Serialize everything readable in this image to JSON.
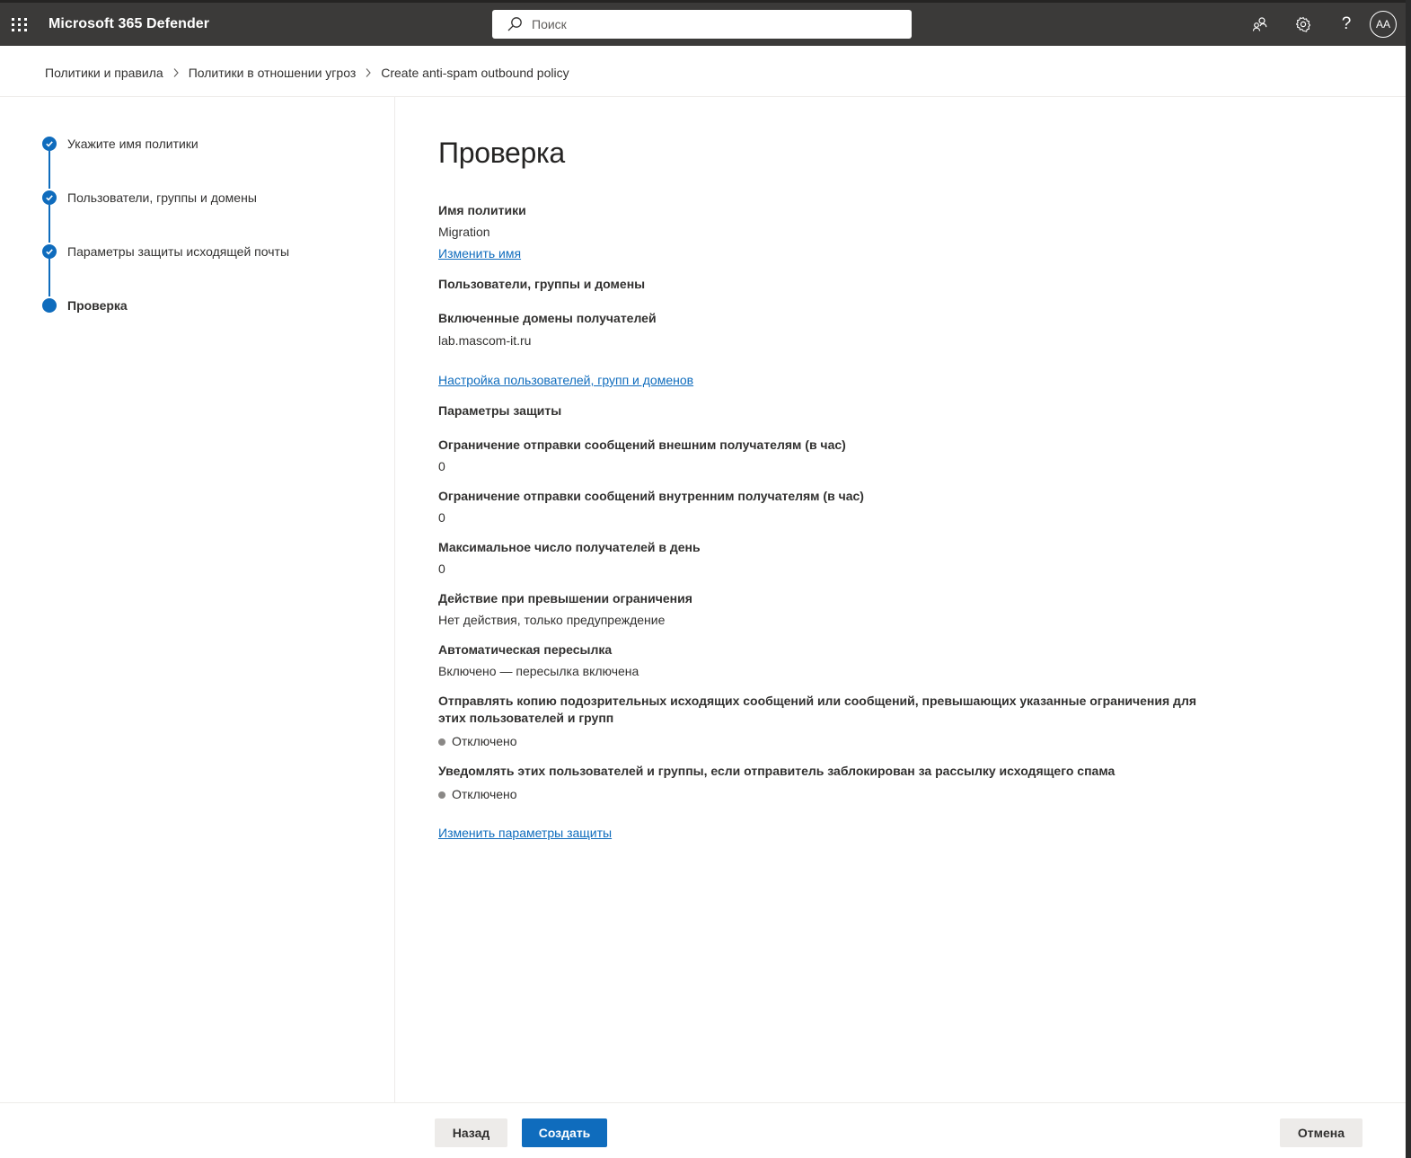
{
  "app": {
    "title": "Microsoft 365 Defender",
    "search_placeholder": "Поиск",
    "avatar_initials": "AA",
    "help_glyph": "?"
  },
  "breadcrumb": [
    {
      "label": "Политики и правила"
    },
    {
      "label": "Политики в отношении угроз"
    },
    {
      "label": "Create anti-spam outbound policy"
    }
  ],
  "steps": [
    {
      "label": "Укажите имя политики",
      "state": "completed"
    },
    {
      "label": "Пользователи, группы и домены",
      "state": "completed"
    },
    {
      "label": "Параметры защиты исходящей почты",
      "state": "completed"
    },
    {
      "label": "Проверка",
      "state": "current"
    }
  ],
  "review": {
    "title": "Проверка",
    "policy_name_heading": "Имя политики",
    "policy_name_value": "Migration",
    "edit_name_link": "Изменить имя",
    "users_section_heading": "Пользователи, группы и домены",
    "included_domains_label": "Включенные домены получателей",
    "included_domains_value": "lab.mascom-it.ru",
    "edit_users_link": "Настройка пользователей, групп и доменов",
    "protection_section_heading": "Параметры защиты",
    "external_limit_label": "Ограничение отправки сообщений внешним получателям (в час)",
    "external_limit_value": "0",
    "internal_limit_label": "Ограничение отправки сообщений внутренним получателям (в час)",
    "internal_limit_value": "0",
    "daily_limit_label": "Максимальное число получателей в день",
    "daily_limit_value": "0",
    "limit_action_label": "Действие при превышении ограничения",
    "limit_action_value": "Нет действия, только предупреждение",
    "autoforward_label": "Автоматическая пересылка",
    "autoforward_value": "Включено — пересылка включена",
    "copy_suspicious_label": "Отправлять копию подозрительных исходящих сообщений или сообщений, превышающих указанные ограничения для этих пользователей и групп",
    "copy_suspicious_value": "Отключено",
    "notify_blocked_label": "Уведомлять этих пользователей и группы, если отправитель заблокирован за рассылку исходящего спама",
    "notify_blocked_value": "Отключено",
    "edit_protection_link": "Изменить параметры защиты"
  },
  "footer": {
    "back_label": "Назад",
    "create_label": "Создать",
    "cancel_label": "Отмена"
  },
  "colors": {
    "accent": "#0f6cbd",
    "topbar": "#3b3a39",
    "status_off": "#8a8886"
  }
}
